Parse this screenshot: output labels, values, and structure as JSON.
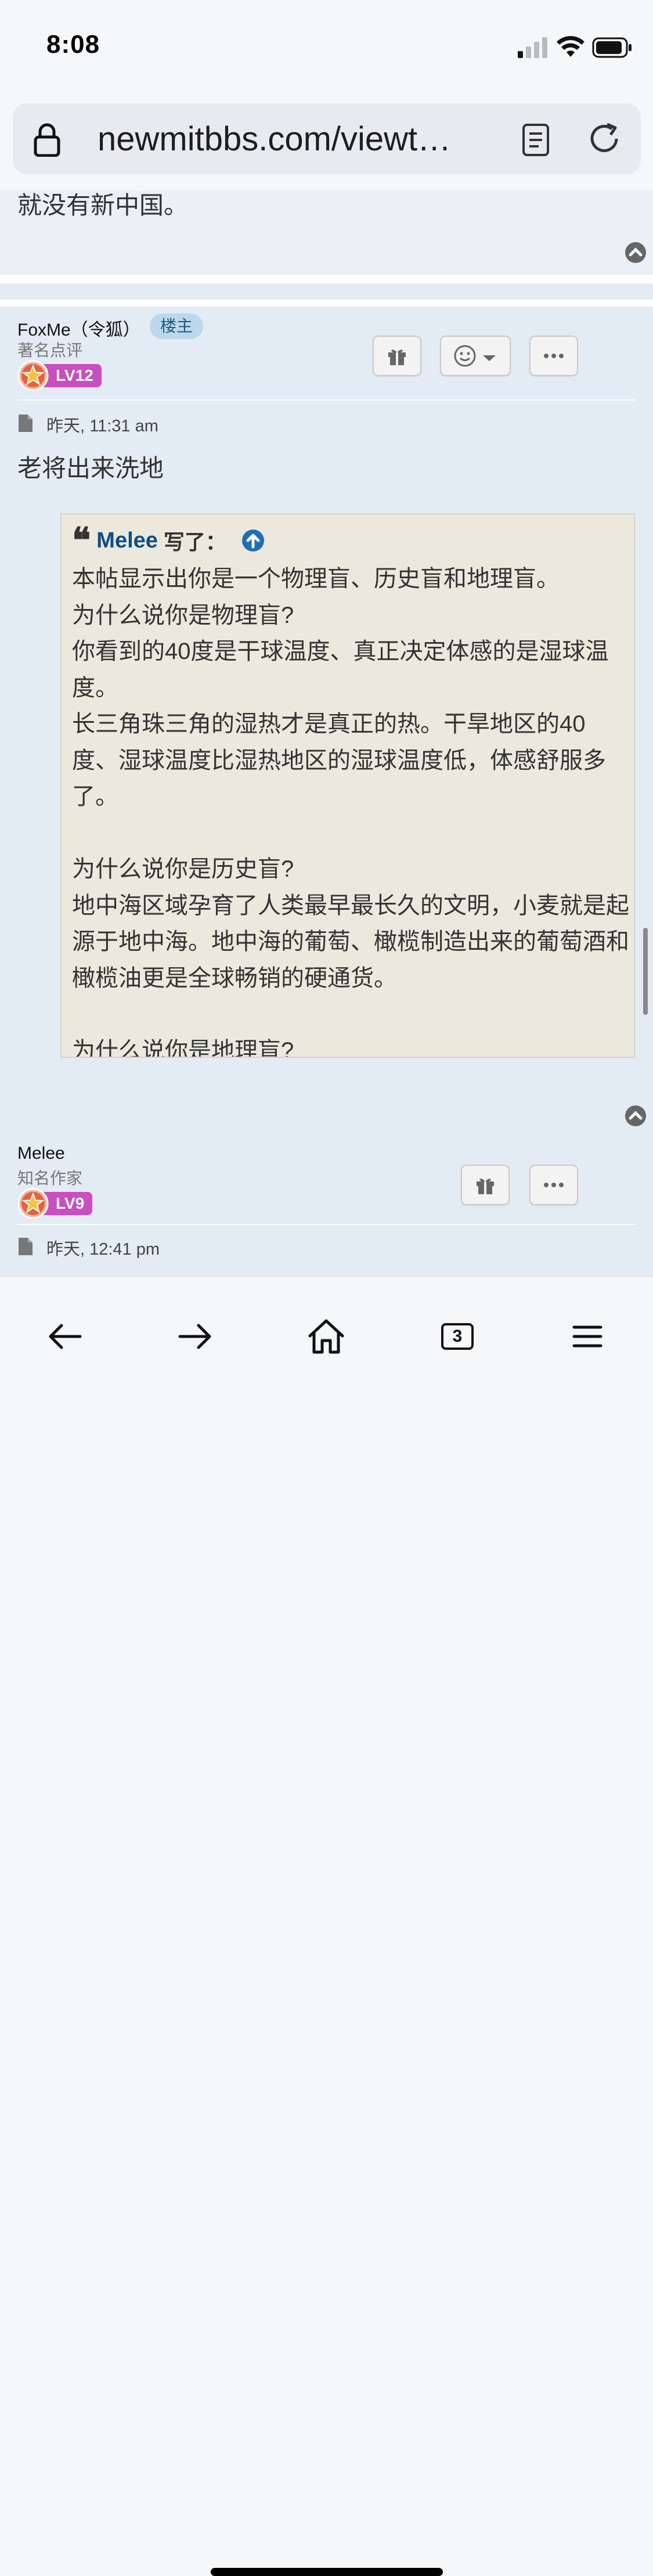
{
  "status_bar": {
    "time": "8:08"
  },
  "browser": {
    "url": "newmitbbs.com/viewt…"
  },
  "prev_post": {
    "text": "就没有新中国。"
  },
  "post": {
    "username": "FoxMe（令狐）",
    "owner_badge": "楼主",
    "user_title": "著名点评",
    "level": "LV12",
    "timestamp": "昨天, 11:31 am",
    "text": "老将出来洗地",
    "quote": {
      "mark": "❝",
      "author": "Melee",
      "wrote": "写了：",
      "body": "本帖显示出你是一个物理盲、历史盲和地理盲。\n为什么说你是物理盲?\n你看到的40度是干球温度、真正决定体感的是湿球温度。\n长三角珠三角的湿热才是真正的热。干旱地区的40度、湿球温度比湿热地区的湿球温度低，体感舒服多了。\n\n为什么说你是历史盲?\n地中海区域孕育了人类最早最长久的文明，小麦就是起源于地中海。地中海的葡萄、橄榄制造出来的葡萄酒和橄榄油更是全球畅销的硬通货。\n\n为什么说你是地理盲?"
    }
  },
  "post2": {
    "username": "Melee",
    "user_title": "知名作家",
    "level": "LV9",
    "timestamp": "昨天, 12:41 pm"
  },
  "toolbar": {
    "tab_count": "3"
  },
  "colors": {
    "post_bg": "#e3ecf4",
    "quote_bg": "#ebe9dd",
    "link": "#0d4d8a",
    "badge": "#c84fc0"
  }
}
